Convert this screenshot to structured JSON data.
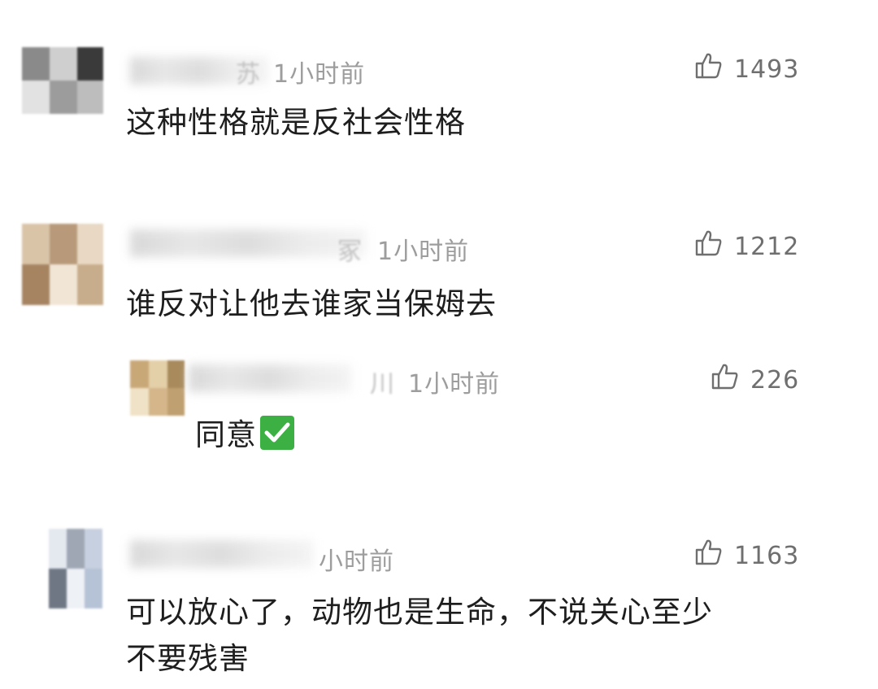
{
  "comments": [
    {
      "name_tail": "苏",
      "time": "1小时前",
      "likes": "1493",
      "text": "这种性格就是反社会性格",
      "avatar_colors": [
        "#8a8a8a",
        "#cfcfcf",
        "#3a3a3a",
        "#e2e2e2",
        "#9c9c9c",
        "#bdbdbd"
      ]
    },
    {
      "name_tail": "冢",
      "time": "1小时前",
      "likes": "1212",
      "text": "谁反对让他去谁家当保姆去",
      "avatar_colors": [
        "#d9c4a8",
        "#b89a7a",
        "#e8d8c4",
        "#a68462",
        "#f1e6d6",
        "#c8ad8c"
      ],
      "replies": [
        {
          "name_tail": "川",
          "time": "1小时前",
          "likes": "226",
          "text": "同意",
          "emoji": "check-mark",
          "avatar_colors": [
            "#c9a878",
            "#e3cfa8",
            "#a88a5c",
            "#f0e2c6",
            "#d4b68a",
            "#bfa070"
          ]
        }
      ]
    },
    {
      "name_tail": "",
      "time": "小时前",
      "likes": "1163",
      "text_lines": [
        "可以放心了，动物也是生命，不说关心至少",
        "不要残害"
      ],
      "avatar_colors": [
        "#e4e8ef",
        "#9fa7b4",
        "#c7d0e0",
        "#6f7785",
        "#eef1f6",
        "#b6c2d6"
      ]
    }
  ]
}
